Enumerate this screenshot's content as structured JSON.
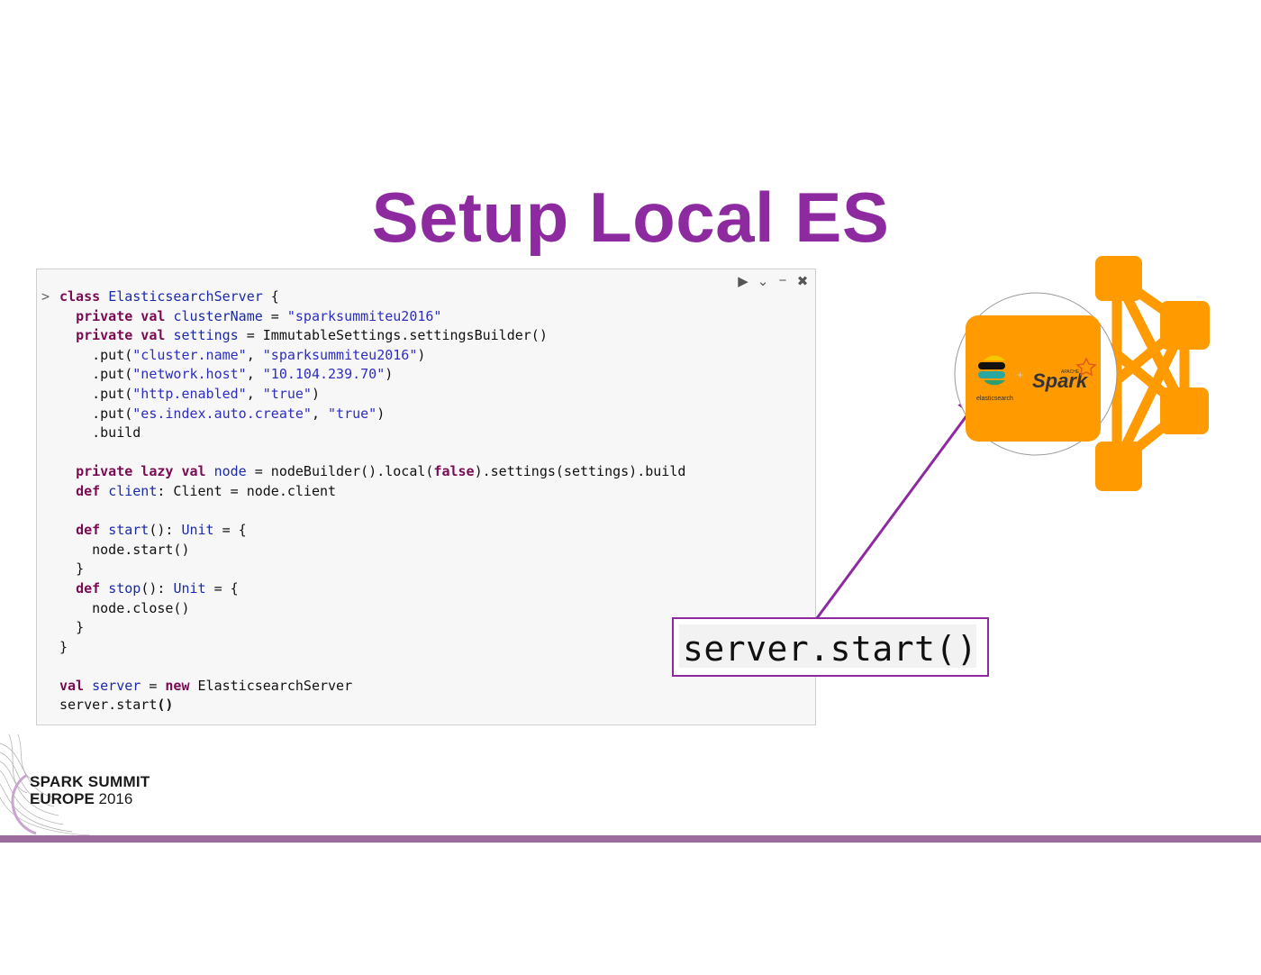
{
  "slide": {
    "title": "Setup Local ES"
  },
  "notebook_cell": {
    "prompt": ">",
    "toolbar": {
      "run_icon": "play-icon",
      "collapse_icon": "chevron-down-icon",
      "minimize_icon": "minus-icon",
      "close_icon": "close-icon"
    },
    "code": {
      "l1_kw": "class",
      "l1_name": "ElasticsearchServer",
      "l1_rest": " {",
      "l2_kw": "private val",
      "l2_name": "clusterName",
      "l2_eq": " = ",
      "l2_str": "\"sparksummiteu2016\"",
      "l3_kw": "private val",
      "l3_name": "settings",
      "l3_rest": " = ImmutableSettings.settingsBuilder()",
      "l4_a": ".put(",
      "l4_s1": "\"cluster.name\"",
      "l4_b": ", ",
      "l4_s2": "\"sparksummiteu2016\"",
      "l4_c": ")",
      "l5_a": ".put(",
      "l5_s1": "\"network.host\"",
      "l5_b": ", ",
      "l5_s2": "\"10.104.239.70\"",
      "l5_c": ")",
      "l6_a": ".put(",
      "l6_s1": "\"http.enabled\"",
      "l6_b": ", ",
      "l6_s2": "\"true\"",
      "l6_c": ")",
      "l7_a": ".put(",
      "l7_s1": "\"es.index.auto.create\"",
      "l7_b": ", ",
      "l7_s2": "\"true\"",
      "l7_c": ")",
      "l8": ".build",
      "l9_kw": "private lazy val",
      "l9_name": "node",
      "l9_a": " = nodeBuilder().local(",
      "l9_false": "false",
      "l9_b": ").settings(settings).build",
      "l10_kw": "def",
      "l10_name": "client",
      "l10_rest": ": Client = node.client",
      "l11_kw": "def",
      "l11_name": "start",
      "l11_a": "(): ",
      "l11_type": "Unit",
      "l11_b": " = {",
      "l12": "node.start()",
      "l13": "}",
      "l14_kw": "def",
      "l14_name": "stop",
      "l14_a": "(): ",
      "l14_type": "Unit",
      "l14_b": " = {",
      "l15": "node.close()",
      "l16": "}",
      "l17": "}",
      "l18_kw": "val",
      "l18_name": "server",
      "l18_a": " = ",
      "l18_new": "new",
      "l18_b": " ElasticsearchServer",
      "l19_a": "server.start",
      "l19_paren": "()"
    }
  },
  "callout": {
    "text": "server.start()"
  },
  "diagram": {
    "es_label": "elasticsearch",
    "plus": "+",
    "spark_small": "APACHE",
    "spark_label": "Spark",
    "color": "#ff9a00"
  },
  "footer": {
    "logo_line1": "SPARK SUMMIT",
    "logo_line2_bold": "EUROPE",
    "logo_line2_year": " 2016",
    "bar_color": "#9e6b9f"
  }
}
